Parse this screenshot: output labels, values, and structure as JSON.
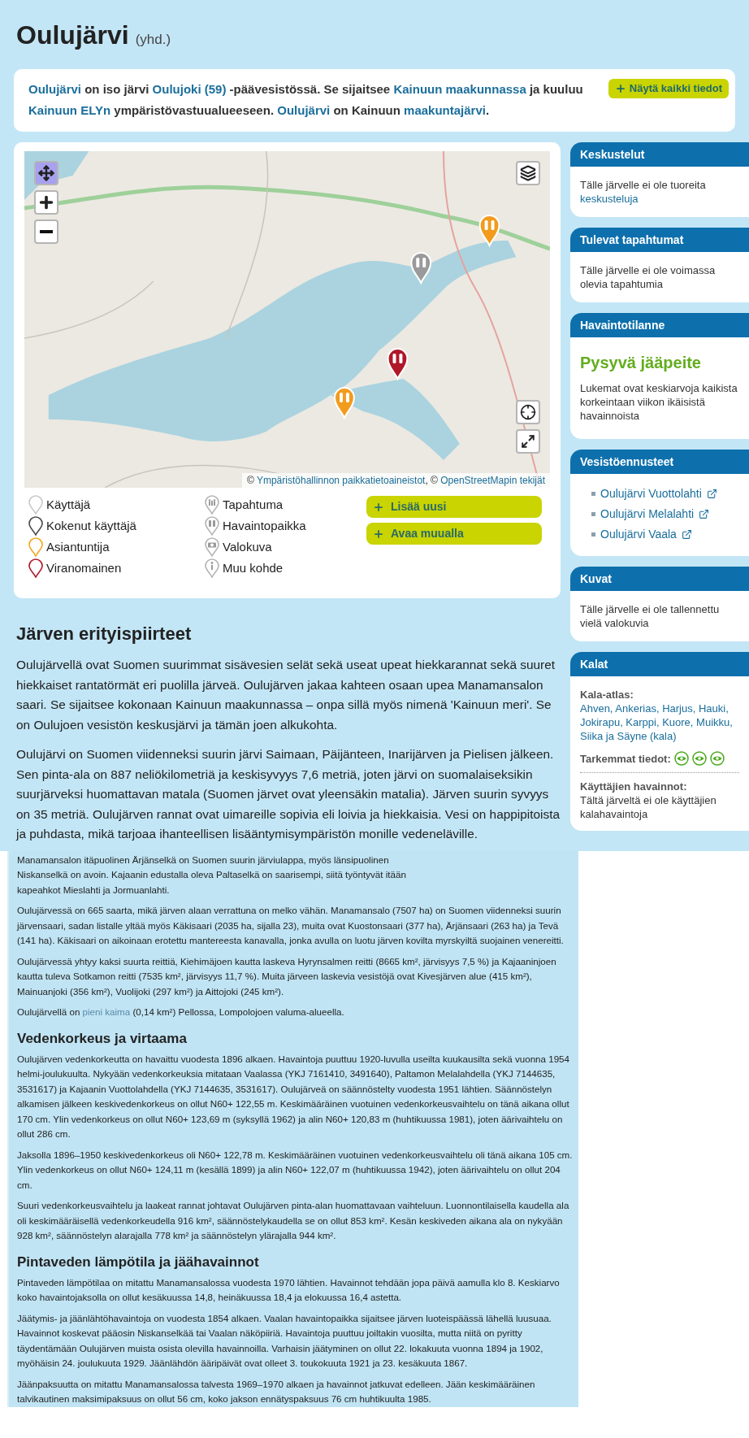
{
  "title": {
    "name": "Oulujärvi",
    "suffix": "(yhd.)"
  },
  "intro": {
    "button": "Näytä kaikki tiedot",
    "segments": [
      {
        "text": "Oulujärvi",
        "link": true
      },
      {
        "text": " on iso järvi "
      },
      {
        "text": "Oulujoki (59)",
        "link": true
      },
      {
        "text": " -päävesistössä. Se sijaitsee "
      },
      {
        "text": "Kainuun maakunnassa",
        "link": true
      },
      {
        "text": " ja kuuluu "
      },
      {
        "text": "Kainuun ELYn",
        "link": true
      },
      {
        "text": " ympäristövastuualueeseen. "
      },
      {
        "text": "Oulujärvi",
        "link": true
      },
      {
        "text": " on Kainuun "
      },
      {
        "text": "maakuntajärvi",
        "link": true
      },
      {
        "text": "."
      }
    ]
  },
  "map": {
    "attribution": [
      {
        "text": "© "
      },
      {
        "text": "Ympäristöhallinnon paikkatietoaineistot",
        "link": true
      },
      {
        "text": ", © "
      },
      {
        "text": "OpenStreetMapin tekijät",
        "link": true
      }
    ]
  },
  "legend": {
    "user_types": [
      {
        "label": "Käyttäjä",
        "color": "#c8c8c8"
      },
      {
        "label": "Kokenut käyttäjä",
        "color": "#4a4a4a"
      },
      {
        "label": "Asiantuntija",
        "color": "#f0a81c"
      },
      {
        "label": "Viranomainen",
        "color": "#b0182a"
      }
    ],
    "place_types": [
      "Tapahtuma",
      "Havaintopaikka",
      "Valokuva",
      "Muu kohde"
    ],
    "buttons": [
      "Lisää uusi",
      "Avaa muualla"
    ]
  },
  "features": {
    "heading": "Järven erityispiirteet",
    "paragraphs": [
      "Oulujärvellä ovat Suomen suurimmat sisävesien selät sekä useat upeat hiekkarannat sekä suuret hiekkaiset rantatörmät eri puolilla järveä. Oulujärven jakaa kahteen osaan upea Manamansalon saari. Se sijaitsee kokonaan Kainuun maakunnassa – onpa sillä myös nimenä 'Kainuun meri'. Se on Oulujoen vesistön keskusjärvi ja tämän joen alkukohta.",
      "Oulujärvi on Suomen viidenneksi suurin järvi Saimaan, Päijänteen, Inarijärven ja Pielisen jälkeen. Sen pinta-ala on 887 neliökilometriä ja keskisyvyys 7,6 metriä, joten järvi on suomalaiseksikin suurjärveksi huomattavan matala (Suomen järvet ovat yleensäkin matalia). Järven suurin syvyys on 35 metriä. Oulujärven rannat ovat uimareille sopivia eli loivia ja hiekkaisia. Vesi on happipitoista ja puhdasta, mikä tarjoaa ihanteellisen lisääntymisympäristön monille vedeneläville."
    ]
  },
  "sidebar": [
    {
      "kind": "text",
      "title": "Keskustelut",
      "segments": [
        {
          "text": "Tälle järvelle ei ole tuoreita "
        },
        {
          "text": "keskusteluja",
          "link": true
        }
      ]
    },
    {
      "kind": "text",
      "title": "Tulevat tapahtumat",
      "segments": [
        {
          "text": "Tälle järvelle ei ole voimassa olevia tapahtumia"
        }
      ]
    },
    {
      "kind": "status",
      "title": "Havaintotilanne",
      "status": "Pysyvä jääpeite",
      "text": "Lukemat ovat keskiarvoja kaikista korkeintaan viikon ikäisistä havainnoista"
    },
    {
      "kind": "links",
      "title": "Vesistöennusteet",
      "links": [
        "Oulujärvi Vuottolahti",
        "Oulujärvi Melalahti",
        "Oulujärvi Vaala"
      ]
    },
    {
      "kind": "text",
      "title": "Kuvat",
      "segments": [
        {
          "text": "Tälle järvelle ei ole tallennettu vielä valokuvia"
        }
      ]
    },
    {
      "kind": "fish",
      "title": "Kalat",
      "atlas_label": "Kala-atlas:",
      "atlas_link": "Ahven, Ankerias, Harjus, Hauki, Jokirapu, Karppi, Kuore, Muikku, Siika ja Säyne (kala)",
      "details_label": "Tarkemmat tiedot:",
      "observations_label": "Käyttäjien havainnot:",
      "observations_text": "Tältä järveltä ei ole käyttäjien kalahavaintoja"
    }
  ],
  "lower_sections": [
    {
      "paragraphs": [
        [
          {
            "text": "Manamansalon itäpuolinen Ärjänselkä on Suomen suurin järviulappa, myös länsipuolinen Niskanselkä on avoin. Kajaanin edustalla oleva Paltaselkä on saarisempi, siitä työntyvät itään kapeahkot Mieslahti ja Jormuanlahti."
          }
        ],
        [
          {
            "text": "Oulujärvessä on 665 saarta, mikä järven alaan verrattuna on melko vähän. Manamansalo (7507 ha) on Suomen viidenneksi suurin järvensaari, sadan listalle yltää myös Käkisaari (2035 ha, sijalla 23), muita ovat Kuostonsaari (377 ha), Ärjänsaari (263 ha) ja Tevä (141 ha). Käkisaari on aikoinaan erotettu mantereesta kanavalla, jonka avulla on luotu järven kovilta myrskyiltä suojainen venereitti."
          }
        ],
        [
          {
            "text": "Oulujärvessä yhtyy kaksi suurta reittiä, Kiehimäjoen kautta laskeva Hyrynsalmen reitti (8665 km², järvisyys 7,5 %) ja Kajaaninjoen kautta tuleva Sotkamon reitti (7535 km², järvisyys 11,7 %). Muita järveen laskevia vesistöjä ovat Kivesjärven alue (415 km²), Mainuanjoki (356 km²), Vuolijoki (297 km²) ja Aittojoki (245 km²)."
          }
        ],
        [
          {
            "text": "Oulujärvellä on "
          },
          {
            "text": "pieni kaima",
            "link": true
          },
          {
            "text": " (0,14 km²) Pellossa, Lompolojoen valuma-alueella."
          }
        ]
      ]
    },
    {
      "heading": "Vedenkorkeus ja virtaama",
      "paragraphs": [
        [
          {
            "text": "Oulujärven vedenkorkeutta on havaittu vuodesta 1896 alkaen. Havaintoja puuttuu 1920-luvulla useilta kuukausilta sekä vuonna 1954 helmi-joulukuulta. Nykyään vedenkorkeuksia mitataan Vaalassa (YKJ 7161410, 3491640), Paltamon Melalahdella (YKJ 7144635, 3531617) ja Kajaanin Vuottolahdella (YKJ 7144635, 3531617). Oulujärveä on säännöstelty vuodesta 1951 lähtien. Säännöstelyn alkamisen jälkeen keskivedenkorkeus on ollut N60+ 122,55 m. Keskimääräinen vuotuinen vedenkorkeusvaihtelu on tänä aikana ollut 170 cm. Ylin vedenkorkeus on ollut N60+ 123,69 m (syksyllä 1962) ja alin N60+ 120,83 m (huhtikuussa 1981), joten äärivaihtelu on ollut 286 cm."
          }
        ],
        [
          {
            "text": "Jaksolla 1896–1950 keskivedenkorkeus oli N60+ 122,78 m. Keskimääräinen vuotuinen vedenkorkeusvaihtelu oli tänä aikana 105 cm. Ylin vedenkorkeus on ollut N60+ 124,11 m (kesällä 1899) ja alin N60+ 122,07 m (huhtikuussa 1942), joten äärivaihtelu on ollut 204 cm."
          }
        ],
        [
          {
            "text": "Suuri vedenkorkeusvaihtelu ja laakeat rannat johtavat Oulujärven pinta-alan huomattavaan vaihteluun. Luonnontilaisella kaudella ala oli keskimääräisellä vedenkorkeudella 916 km², säännöstelykaudella se on ollut 853 km². Kesän keskiveden aikana ala on nykyään 928 km², säännöstelyn alarajalla 778 km² ja säännöstelyn ylärajalla 944 km²."
          }
        ]
      ]
    },
    {
      "heading": "Pintaveden lämpötila ja jäähavainnot",
      "paragraphs": [
        [
          {
            "text": "Pintaveden lämpötilaa on mitattu Manamansalossa vuodesta 1970 lähtien. Havainnot tehdään jopa päivä aamulla klo 8. Keskiarvo koko havaintojaksolla on ollut kesäkuussa 14,8, heinäkuussa 18,4 ja elokuussa 16,4 astetta."
          }
        ],
        [
          {
            "text": "Jäätymis- ja jäänlähtöhavaintoja on vuodesta 1854 alkaen. Vaalan havaintopaikka sijaitsee järven luoteispäässä lähellä luusuaa. Havainnot koskevat pääosin Niskanselkää tai Vaalan näköpiiriä. Havaintoja puuttuu joiltakin vuosilta, mutta niitä on pyritty täydentämään Oulujärven muista osista olevilla havainnoilla. Varhaisin jäätyminen on ollut 22. lokakuuta vuonna 1894 ja 1902, myöhäisin 24. joulukuuta 1929. Jäänlähdön ääripäivät ovat olleet 3. toukokuuta 1921 ja 23. kesäkuuta 1867."
          }
        ],
        [
          {
            "text": "Jäänpaksuutta on mitattu Manamansalossa talvesta 1969–1970 alkaen ja havainnot jatkuvat edelleen. Jään keskimääräinen talvikautinen maksimipaksuus on ollut 56 cm, koko jakson ennätyspaksuus 76 cm huhtikuulta 1985."
          }
        ]
      ]
    }
  ]
}
